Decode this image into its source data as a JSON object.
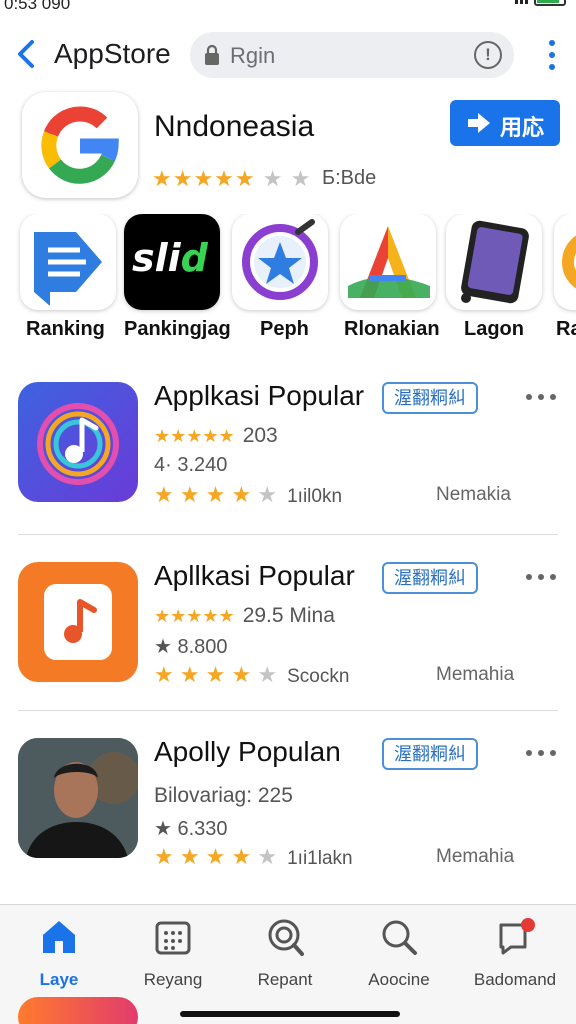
{
  "status": {
    "time": "0:53 090"
  },
  "header": {
    "title": "AppStore",
    "search_value": "Rgin",
    "search_icon": "lock-icon",
    "info_icon": "info-icon",
    "menu_icon": "more-vert-icon"
  },
  "featured": {
    "name": "Nndoneasia",
    "rating": 4,
    "sub": "Б:Bde",
    "install_label": "用応"
  },
  "categories": [
    {
      "label": "Ranking",
      "icon": "document-list-icon"
    },
    {
      "label": "Pankingjag",
      "icon": "slid-logo-icon"
    },
    {
      "label": "Peph",
      "icon": "star-circle-icon"
    },
    {
      "label": "Rlonakian",
      "icon": "triangle-logo-icon"
    },
    {
      "label": "Lagon",
      "icon": "tablet-icon"
    },
    {
      "label": "Ra",
      "icon": "partial-icon"
    }
  ],
  "apps": [
    {
      "title": "Applkasi Popular",
      "badge": "渥翻粡糾",
      "line2_stars": "★★★★★",
      "line2_text": "203",
      "line3": "4· 3.240",
      "rating": 4,
      "downloads": "1ıil0kn",
      "meta": "Nemakia",
      "icon": "music-circle-icon"
    },
    {
      "title": "Apllkasi Popular",
      "badge": "渥翻粡糾",
      "line2_stars": "★★★★★",
      "line2_text": "29.5  Mina",
      "line3": "★ 8.800",
      "rating": 4,
      "downloads": "Scockn",
      "meta": "Memahia",
      "icon": "music-note-icon"
    },
    {
      "title": "Apolly Populan",
      "badge": "渥翻粡糾",
      "line2_stars": "",
      "line2_text": "Bilovariag: 225",
      "line3": "★ 6.330",
      "rating": 4,
      "downloads": "1ıi1lakn",
      "meta": "Memahia",
      "icon": "person-photo-icon"
    }
  ],
  "nav": [
    {
      "label": "Laye",
      "icon": "home-icon",
      "active": true
    },
    {
      "label": "Reyang",
      "icon": "grid-icon",
      "active": false
    },
    {
      "label": "Repant",
      "icon": "search-badge-icon",
      "active": false
    },
    {
      "label": "Aoocine",
      "icon": "search-icon",
      "active": false
    },
    {
      "label": "Badomand",
      "icon": "notification-icon",
      "active": false
    }
  ],
  "colors": {
    "accent": "#1a73e8",
    "star": "#f5a623",
    "badge": "#4a90d9"
  }
}
